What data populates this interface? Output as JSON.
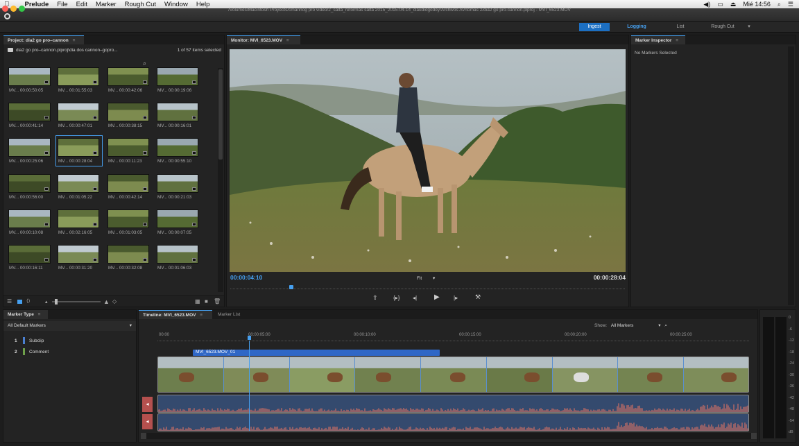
{
  "menubar": {
    "apple": "",
    "app_name": "Prelude",
    "items": [
      "File",
      "Edit",
      "Marker",
      "Rough Cut",
      "Window",
      "Help"
    ],
    "clock": "Mié 14:56"
  },
  "window": {
    "path": "/Volumes/Macintosh Proyects/cmarinog pro video/2_salta_reformas salta 2015_2015-04-14_claudiogodoy/Archivos AV/tomas 2/dia2 go pro-cannon.plproj - MVI_6523.MOV"
  },
  "workspaces": {
    "ingest": "Ingest",
    "logging": "Logging",
    "list": "List",
    "rough_cut": "Rough Cut"
  },
  "project": {
    "tab": "Project: dia2 go pro–cannon",
    "menu_glyph": "≡",
    "path": "dia2 go pro–cannon.plproj\\dia dos cannon–gopro...",
    "count": "1 of 57 items selected",
    "clips": [
      [
        "MV... 00:00:50:05",
        "MV... 00:01:55:03",
        "MV... 00:00:42:06",
        "MV... 00:00:19:06"
      ],
      [
        "MV... 00:00:41:14",
        "MV... 00:00:47:01",
        "MV... 00:00:38:15",
        "MV... 00:00:16:01"
      ],
      [
        "MV... 00:00:25:06",
        "MV... 00:00:28:04",
        "MV... 00:00:11:23",
        "MV... 00:00:55:10"
      ],
      [
        "MV... 00:00:56:00",
        "MV... 00:01:05:22",
        "MV... 00:00:42:14",
        "MV... 00:00:21:03"
      ],
      [
        "MV... 00:00:10:08",
        "MV... 00:02:16:05",
        "MV... 00:01:03:05",
        "MV... 00:00:07:05"
      ],
      [
        "MV... 00:00:16:11",
        "MV... 00:00:31:20",
        "MV... 00:00:32:08",
        "MV... 00:01:06:03"
      ]
    ]
  },
  "monitor": {
    "tab": "Monitor: MVI_6523.MOV",
    "current_tc": "00:00:04:10",
    "duration_tc": "00:00:28:04",
    "zoom": "Fit",
    "playhead_fraction": 0.15
  },
  "inspector": {
    "tab": "Marker Inspector",
    "empty": "No Markers Selected"
  },
  "marker_type": {
    "tab": "Marker Type",
    "filter": "All Default Markers",
    "types": [
      {
        "num": "1",
        "name": "Subclip",
        "color": "#4a7fd0"
      },
      {
        "num": "2",
        "name": "Comment",
        "color": "#6ea04a"
      }
    ]
  },
  "timeline": {
    "tab": "Timeline: MVI_6523.MOV",
    "tab2": "Marker List",
    "show_label": "Show:",
    "show_value": "All Markers",
    "ruler": [
      "00:00",
      "00:00:05:00",
      "00:00:10:00",
      "00:00:15:00",
      "00:00:20:00",
      "00:00:25:00"
    ],
    "subclip": "MVI_6523.MOV_01"
  },
  "meter": {
    "ticks": [
      "0",
      "-6",
      "-12",
      "-18",
      "-24",
      "-30",
      "-36",
      "-42",
      "-48",
      "-54",
      "dB"
    ]
  },
  "colors": {
    "accent": "#46a0f0",
    "ingest": "#1c6fc2",
    "audio": "#b86a66",
    "subclip": "#2f67c6"
  }
}
